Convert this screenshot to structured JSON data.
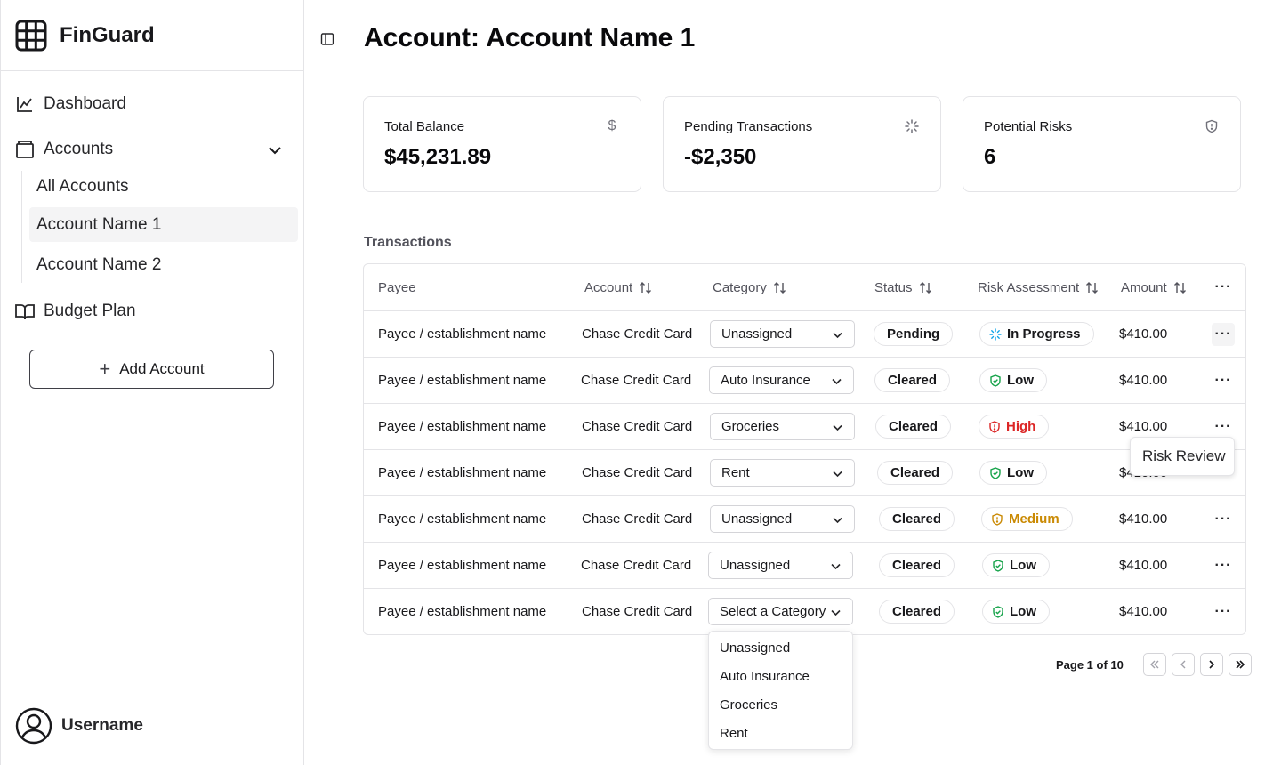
{
  "app": {
    "name": "FinGuard"
  },
  "sidebar": {
    "dashboard": "Dashboard",
    "accounts": "Accounts",
    "sub_items": [
      "All Accounts",
      "Account Name 1",
      "Account Name 2"
    ],
    "budget": "Budget Plan",
    "add_account": "Add Account",
    "username": "Username"
  },
  "page": {
    "title": "Account: Account Name 1"
  },
  "cards": [
    {
      "label": "Total Balance",
      "value": "$45,231.89",
      "icon": "dollar-icon"
    },
    {
      "label": "Pending Transactions",
      "value": "-$2,350",
      "icon": "loader-icon"
    },
    {
      "label": "Potential Risks",
      "value": "6",
      "icon": "shield-alert-icon"
    }
  ],
  "transactions": {
    "title": "Transactions",
    "columns": [
      "Payee",
      "Account",
      "Category",
      "Status",
      "Risk Assessment",
      "Amount"
    ],
    "rows": [
      {
        "payee": "Payee / establishment name",
        "account": "Chase Credit Card",
        "category": "Unassigned",
        "status": "Pending",
        "risk": "In Progress",
        "amount": "$410.00"
      },
      {
        "payee": "Payee / establishment name",
        "account": "Chase Credit Card",
        "category": "Auto Insurance",
        "status": "Cleared",
        "risk": "Low",
        "amount": "$410.00"
      },
      {
        "payee": "Payee / establishment name",
        "account": "Chase Credit Card",
        "category": "Groceries",
        "status": "Cleared",
        "risk": "High",
        "amount": "$410.00"
      },
      {
        "payee": "Payee / establishment name",
        "account": "Chase Credit Card",
        "category": "Rent",
        "status": "Cleared",
        "risk": "Low",
        "amount": "$410.00"
      },
      {
        "payee": "Payee / establishment name",
        "account": "Chase Credit Card",
        "category": "Unassigned",
        "status": "Cleared",
        "risk": "Medium",
        "amount": "$410.00"
      },
      {
        "payee": "Payee / establishment name",
        "account": "Chase Credit Card",
        "category": "Unassigned",
        "status": "Cleared",
        "risk": "Low",
        "amount": "$410.00"
      },
      {
        "payee": "Payee / establishment name",
        "account": "Chase Credit Card",
        "category": "Select a Category",
        "status": "Cleared",
        "risk": "Low",
        "amount": "$410.00"
      }
    ]
  },
  "row_menu_tooltip": "Risk Review",
  "category_options": [
    "Unassigned",
    "Auto Insurance",
    "Groceries",
    "Rent"
  ],
  "pagination": {
    "label": "Page 1 of 10"
  },
  "colors": {
    "risk_high": "#dc2626",
    "risk_medium": "#ca8a04",
    "risk_low_icon": "#16a34a",
    "in_progress_icon": "#0ea5e9"
  }
}
